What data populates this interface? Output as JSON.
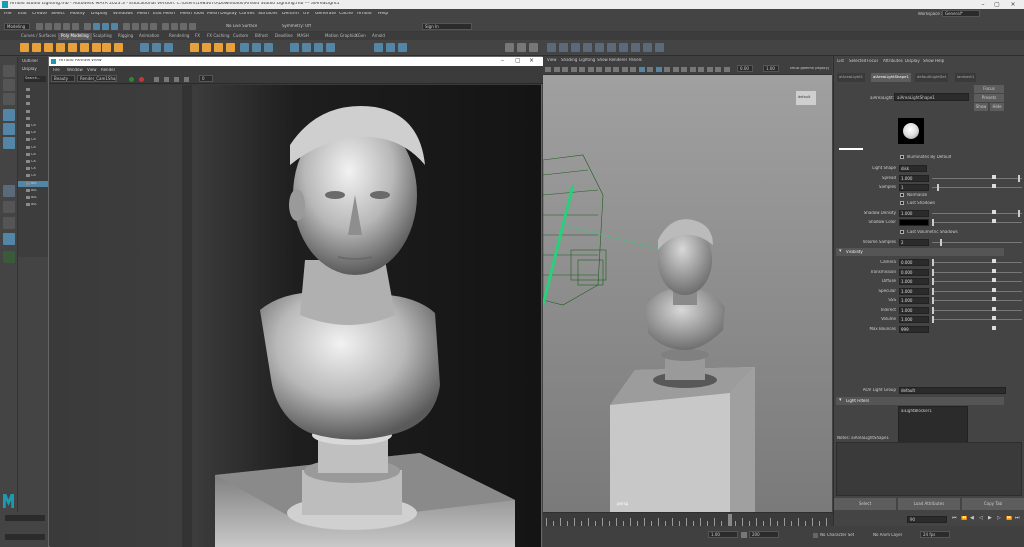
{
  "window": {
    "title": "Arnold Studio Lighting.mb - Autodesk MAYA 2023.3 - Educational Version: C:\\Users\\1983670\\Downloads\\Arnold Studio Lighting.mb  ---  aiAreaLight1"
  },
  "menubar": [
    "File",
    "Edit",
    "Create",
    "Select",
    "Modify",
    "Display",
    "Windows",
    "Mesh",
    "Edit Mesh",
    "Mesh Tools",
    "Mesh Display",
    "Curves",
    "Surfaces",
    "Deform",
    "UV",
    "Generate",
    "Cache",
    "Arnold",
    "Help"
  ],
  "workspace": {
    "label": "Workspace :",
    "value": "General*"
  },
  "status": {
    "menuset": "Modeling",
    "live": "No Live Surface",
    "symmetry": "Symmetry: Off",
    "signin": "Sign In"
  },
  "shelf_tabs": [
    "Curves / Surfaces",
    "Poly Modeling",
    "Sculpting",
    "Rigging",
    "Animation",
    "Rendering",
    "FX",
    "FX Caching",
    "Custom",
    "Bifrost",
    "Deadline",
    "MASH",
    "Motion Graphics",
    "XGen",
    "Arnold"
  ],
  "shelf_active": "Poly Modeling",
  "outliner": {
    "tabs": [
      "Outliner",
      "Display"
    ],
    "search": "Search...",
    "items": [
      "",
      "",
      "",
      "",
      "",
      "Ca",
      "Ca",
      "Ca",
      "Ca",
      "Ca",
      "Ca",
      "Ca",
      "Ca",
      "aiA",
      "aiA",
      "aiA",
      "aiA"
    ]
  },
  "renderview": {
    "title": "Arnold RenderView",
    "menu": [
      "File",
      "Window",
      "View",
      "Render"
    ],
    "toolbar": {
      "beauty": "Beauty",
      "camera": "Render_Cam1Shape",
      "exposure": "0"
    }
  },
  "viewport": {
    "menu": [
      "View",
      "Shading",
      "Lighting",
      "Show",
      "Renderer",
      "Panels"
    ],
    "camera_label": "persp",
    "fields": [
      "0.00",
      "1.00"
    ],
    "colorspace": "sRGB gamma (legacy)",
    "default_btn": "default"
  },
  "attribute_editor": {
    "menu": [
      "List",
      "Selected",
      "Focus",
      "Attributes",
      "Display",
      "Show",
      "Help"
    ],
    "tabs": [
      "aiAreaLight1",
      "aiAreaLightShape1",
      "defaultLightSet",
      "lambert1"
    ],
    "shape_label": "aiAreaLight:",
    "shape_value": "aiAreaLightShape1",
    "buttons": [
      "Focus",
      "Presets",
      "Show",
      "Hide"
    ],
    "illuminates_default": "Illuminates By Default",
    "light_shape": {
      "label": "Light Shape",
      "value": "disk"
    },
    "rows1": [
      {
        "label": "Spread",
        "value": "1.000"
      },
      {
        "label": "Samples",
        "value": "1"
      }
    ],
    "normalize": "Normalize",
    "cast_shadows": "Cast Shadows",
    "rows2": [
      {
        "label": "Shadow Density",
        "value": "1.000"
      },
      {
        "label": "Shadow Color",
        "value": ""
      }
    ],
    "cast_volumetric": "Cast Volumetric Shadows",
    "volume_samples": {
      "label": "Volume Samples",
      "value": "2"
    },
    "visibility_title": "Visibility",
    "visibility": [
      {
        "label": "Camera",
        "value": "0.000"
      },
      {
        "label": "Transmission",
        "value": "0.000"
      },
      {
        "label": "Diffuse",
        "value": "1.000"
      },
      {
        "label": "Specular",
        "value": "1.000"
      },
      {
        "label": "SSS",
        "value": "1.000"
      },
      {
        "label": "Indirect",
        "value": "1.000"
      },
      {
        "label": "Volume",
        "value": "1.000"
      },
      {
        "label": "Max Bounces",
        "value": "999"
      }
    ],
    "aov_group": {
      "label": "AOV Light Group",
      "value": "default"
    },
    "light_filters_title": "Light Filters",
    "filter_item": "aiLightBlocker1",
    "add_btn": "Add",
    "disconnect_btn": "Disconnect",
    "add_menu": "<Add Filters>",
    "notes": "Notes: aiAreaLightShape1",
    "bottom_buttons": [
      "Select",
      "Load Attributes",
      "Copy Tab"
    ]
  },
  "timeline": {
    "current": "90",
    "range_start": "1.00",
    "range_end": "200",
    "character_set": "No Character Set",
    "anim_layer": "No Anim Layer",
    "fps": "24 fps"
  },
  "colors": {
    "accent": "#5285a6",
    "orange_icon": "#e8a13a",
    "maya_teal": "#1b9bb1",
    "selected_green": "#27d17a"
  }
}
